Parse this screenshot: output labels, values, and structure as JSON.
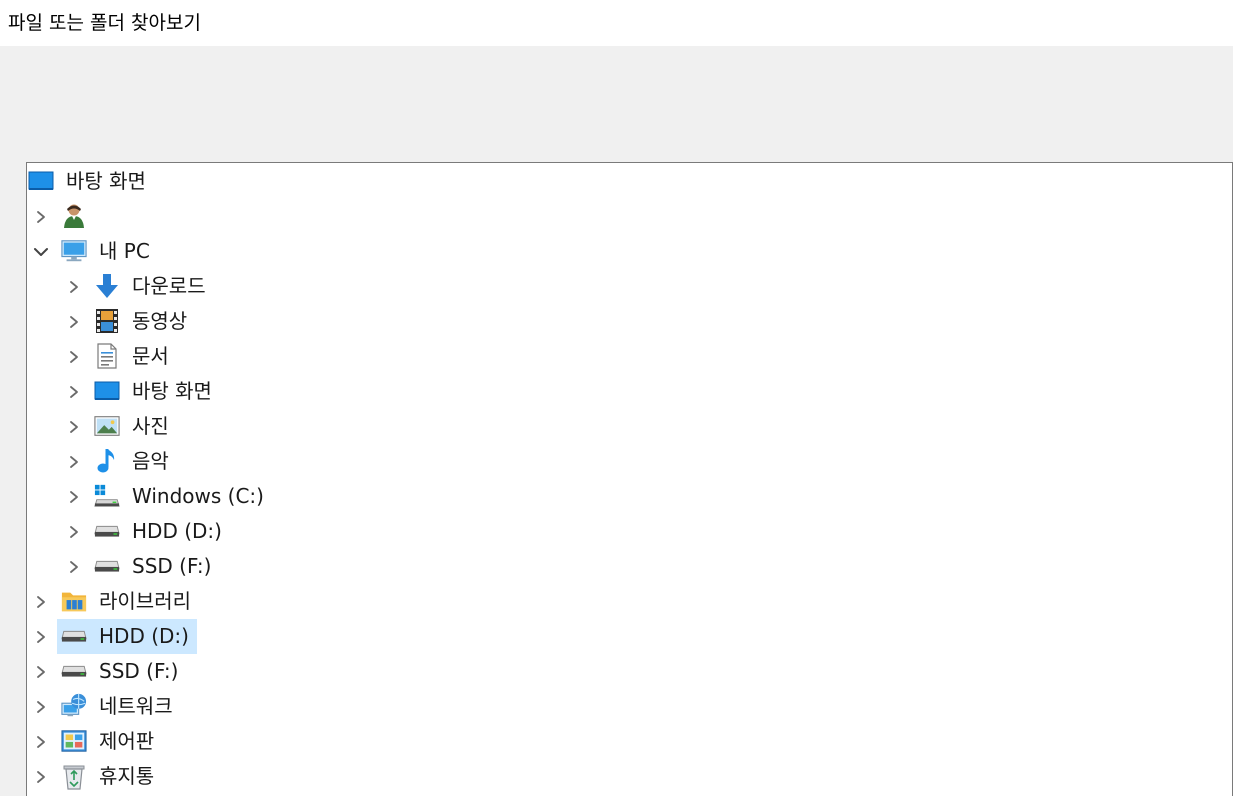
{
  "window": {
    "title": "파일 또는 폴더 찾아보기"
  },
  "tree": {
    "items": [
      {
        "label": "바탕 화면",
        "icon": "desktop-icon",
        "level": 0,
        "expander": "none",
        "selected": false
      },
      {
        "label": "",
        "icon": "user-icon",
        "level": 0,
        "expander": "collapsed",
        "selected": false
      },
      {
        "label": "내 PC",
        "icon": "computer-icon",
        "level": 0,
        "expander": "expanded",
        "selected": false
      },
      {
        "label": "다운로드",
        "icon": "downloads-icon",
        "level": 1,
        "expander": "collapsed",
        "selected": false
      },
      {
        "label": "동영상",
        "icon": "videos-icon",
        "level": 1,
        "expander": "collapsed",
        "selected": false
      },
      {
        "label": "문서",
        "icon": "documents-icon",
        "level": 1,
        "expander": "collapsed",
        "selected": false
      },
      {
        "label": "바탕 화면",
        "icon": "desktop-icon",
        "level": 1,
        "expander": "collapsed",
        "selected": false
      },
      {
        "label": "사진",
        "icon": "pictures-icon",
        "level": 1,
        "expander": "collapsed",
        "selected": false
      },
      {
        "label": "음악",
        "icon": "music-icon",
        "level": 1,
        "expander": "collapsed",
        "selected": false
      },
      {
        "label": "Windows (C:)",
        "icon": "windows-drive-icon",
        "level": 1,
        "expander": "collapsed",
        "selected": false
      },
      {
        "label": "HDD (D:)",
        "icon": "drive-icon",
        "level": 1,
        "expander": "collapsed",
        "selected": false
      },
      {
        "label": "SSD (F:)",
        "icon": "drive-icon",
        "level": 1,
        "expander": "collapsed",
        "selected": false
      },
      {
        "label": "라이브러리",
        "icon": "libraries-icon",
        "level": 0,
        "expander": "collapsed",
        "selected": false
      },
      {
        "label": "HDD (D:)",
        "icon": "drive-icon",
        "level": 0,
        "expander": "collapsed",
        "selected": true
      },
      {
        "label": "SSD (F:)",
        "icon": "drive-icon",
        "level": 0,
        "expander": "collapsed",
        "selected": false
      },
      {
        "label": "네트워크",
        "icon": "network-icon",
        "level": 0,
        "expander": "collapsed",
        "selected": false
      },
      {
        "label": "제어판",
        "icon": "control-panel-icon",
        "level": 0,
        "expander": "collapsed",
        "selected": false
      },
      {
        "label": "휴지통",
        "icon": "recycle-bin-icon",
        "level": 0,
        "expander": "collapsed",
        "selected": false
      }
    ]
  },
  "colors": {
    "selection": "#cce8ff",
    "panel_background": "#f0f0f0",
    "tree_border": "#7a7a7a"
  }
}
